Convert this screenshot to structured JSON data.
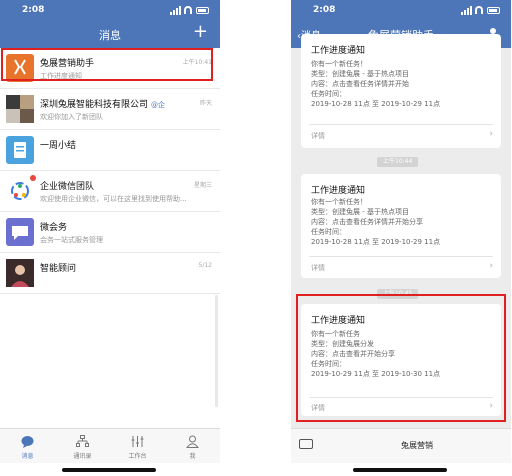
{
  "left": {
    "status": {
      "time": "2:08"
    },
    "nav": {
      "title": "消息",
      "plus": "+"
    },
    "conversations": [
      {
        "name": "兔展营销助手",
        "preview": "工作进度通知",
        "time": "上午10:41",
        "tag": "",
        "avatar_color": "#e8742c"
      },
      {
        "name": "深圳兔展智能科技有限公司",
        "preview": "欢迎你加入了新团队",
        "time": "昨天",
        "tag": "@企",
        "avatar_color": "#7a6a5a"
      },
      {
        "name": "一周小结",
        "preview": "",
        "time": "",
        "tag": "",
        "avatar_color": "#4aa3df"
      },
      {
        "name": "企业微信团队",
        "preview": "欢迎使用企业微信，可以在这里找到使用帮助...",
        "time": "星期三",
        "tag": "",
        "avatar_color": "#ffffff"
      },
      {
        "name": "微会务",
        "preview": "会务一站式服务管理",
        "time": "",
        "tag": "",
        "avatar_color": "#6b6fd0"
      },
      {
        "name": "智能顾问",
        "preview": "",
        "time": "5/12",
        "tag": "",
        "avatar_color": "#c24a5a"
      }
    ],
    "tabs": [
      {
        "label": "消息",
        "icon": "chat-icon"
      },
      {
        "label": "通讯录",
        "icon": "contacts-icon"
      },
      {
        "label": "工作台",
        "icon": "workbench-icon"
      },
      {
        "label": "我",
        "icon": "me-icon"
      }
    ]
  },
  "right": {
    "status": {
      "time": "2:08"
    },
    "nav": {
      "back": "消息",
      "title": "兔展营销助手"
    },
    "cards": [
      {
        "title": "工作进度通知",
        "lines": [
          "你有一个新任务！",
          "类型：创建兔展 - 基于热点项目",
          "内容：点击查看任务详情并开始",
          "任务时间：",
          "2019-10-28 11点 至 2019-10-29 11点"
        ],
        "footer": "详情"
      },
      {
        "title": "工作进度通知",
        "lines": [
          "你有一个新任务！",
          "类型：创建兔展 - 基于热点项目",
          "内容：点击查看任务详情并开始分享",
          "任务时间：",
          "2019-10-28 11点 至 2019-10-29 11点"
        ],
        "footer": "详情"
      },
      {
        "title": "工作进度通知",
        "lines": [
          "你有一个新任务",
          "类型：创建兔展分发",
          "内容：点击查看并开始分享",
          "任务时间：",
          "2019-10-29 11点 至 2019-10-30 11点"
        ],
        "footer": "详情"
      }
    ],
    "timestamps": [
      "上午10:44",
      "上午10:45"
    ],
    "input_menu": "兔展营销"
  }
}
